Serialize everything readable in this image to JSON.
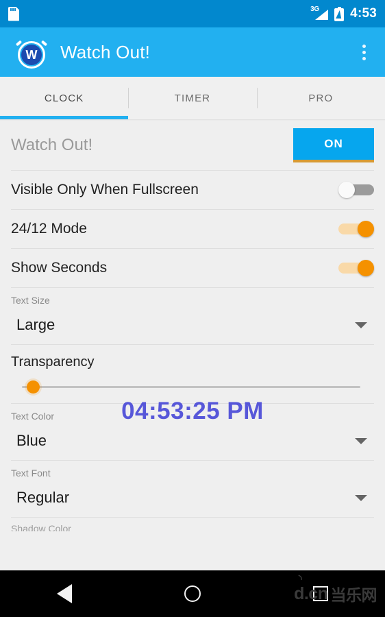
{
  "status_bar": {
    "sd_icon": "sd-card-icon",
    "network_label": "3G",
    "signal_icon": "signal-bars-icon",
    "battery_icon": "battery-charging-icon",
    "time": "4:53"
  },
  "app_bar": {
    "logo_icon": "alarm-clock-logo",
    "logo_letter": "W",
    "title": "Watch Out!",
    "overflow_icon": "overflow-menu-icon",
    "background_color": "#22b0f0"
  },
  "tabs": {
    "items": [
      {
        "label": "CLOCK",
        "active": true
      },
      {
        "label": "TIMER",
        "active": false
      },
      {
        "label": "PRO",
        "active": false
      }
    ],
    "indicator_color": "#22b0f0"
  },
  "settings": {
    "master": {
      "label": "Watch Out!",
      "button_label": "ON",
      "button_color": "#06a6ee",
      "button_accent_color": "#d79a33"
    },
    "switches": [
      {
        "label": "Visible Only When Fullscreen",
        "state": "off"
      },
      {
        "label": "24/12 Mode",
        "state": "on"
      },
      {
        "label": "Show Seconds",
        "state": "on"
      }
    ],
    "text_size": {
      "label": "Text Size",
      "value": "Large"
    },
    "transparency": {
      "label": "Transparency",
      "value": 3
    },
    "text_color": {
      "label": "Text Color",
      "value": "Blue"
    },
    "text_font": {
      "label": "Text Font",
      "value": "Regular"
    },
    "next_label": "Shadow Color",
    "accent_color": "#f59100"
  },
  "clock_overlay": {
    "time": "04:53:25 PM",
    "color": "#3f3fd6"
  },
  "nav_bar": {
    "back_icon": "back-triangle-icon",
    "home_icon": "home-circle-icon",
    "recents_icon": "recents-square-icon"
  },
  "watermark": {
    "latin": "d.cn",
    "chinese": "当乐网"
  }
}
